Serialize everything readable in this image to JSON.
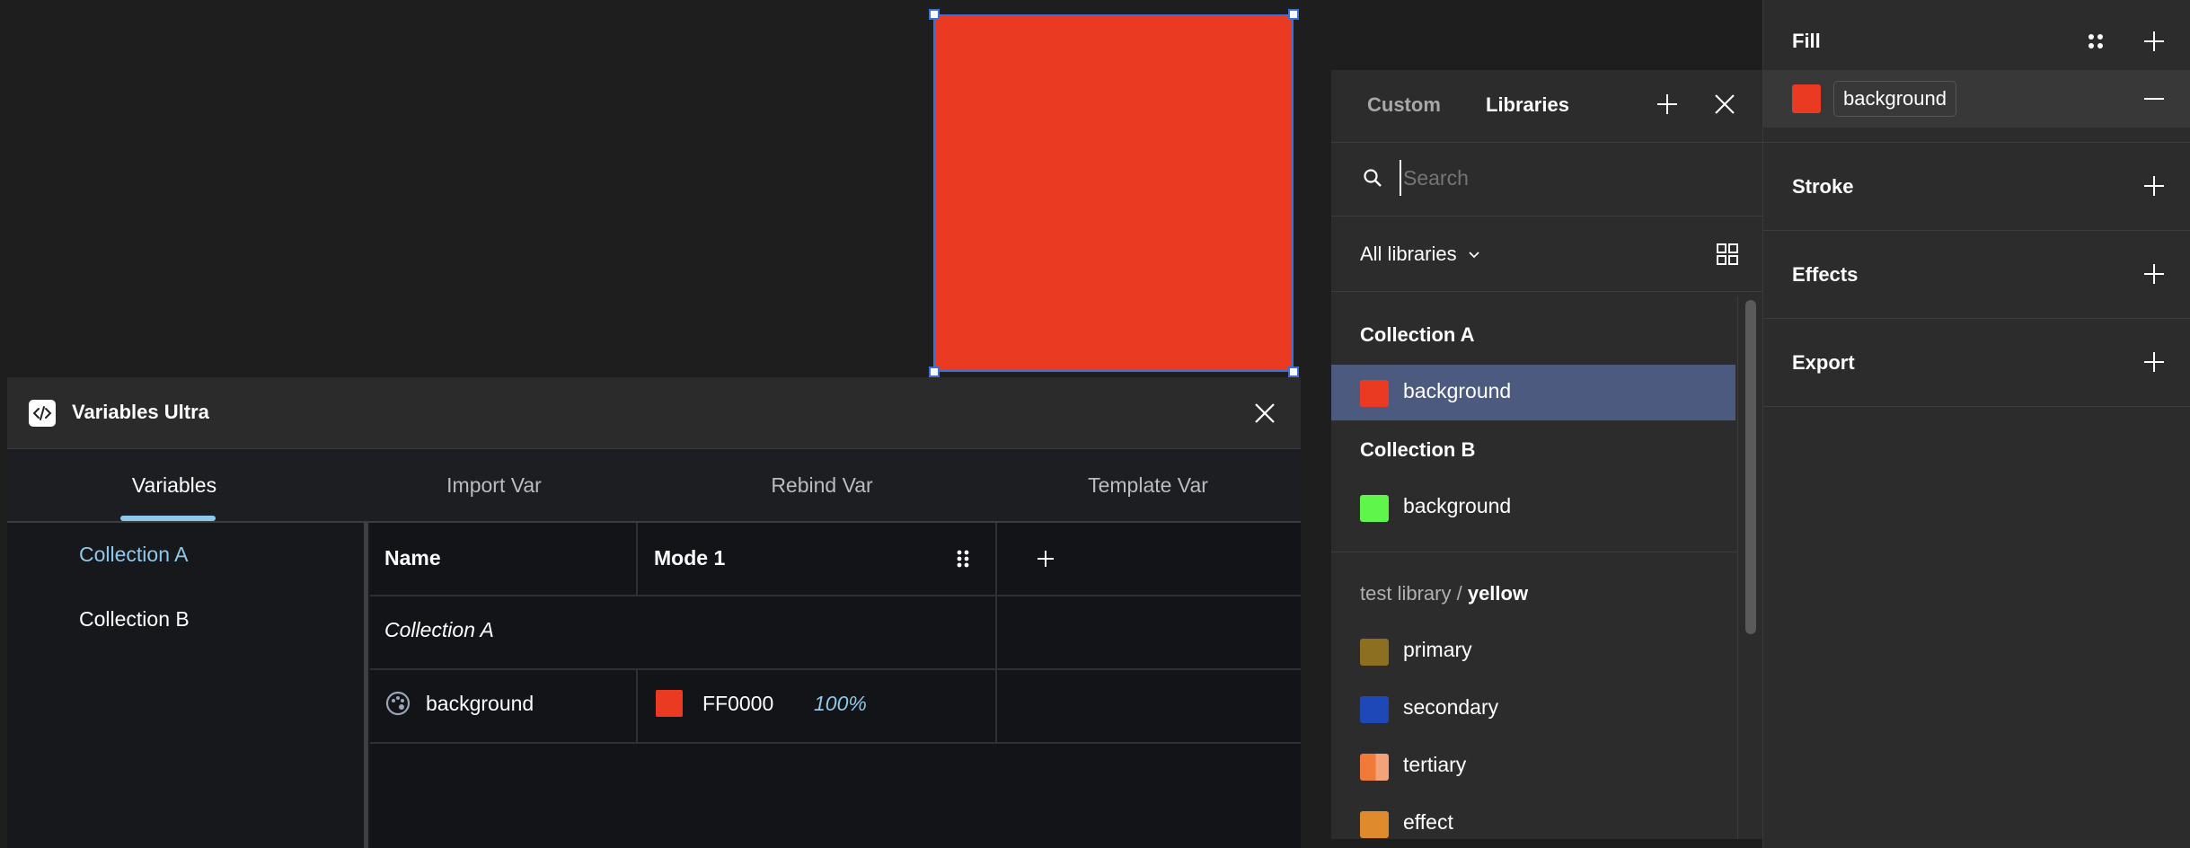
{
  "plugin": {
    "title": "Variables Ultra",
    "tabs": [
      "Variables",
      "Import Var",
      "Rebind Var",
      "Template Var"
    ],
    "collections": [
      "Collection A",
      "Collection B"
    ],
    "table": {
      "col_name": "Name",
      "col_mode": "Mode 1",
      "group_label": "Collection A",
      "row": {
        "name": "background",
        "hex": "FF0000",
        "opacity": "100%",
        "swatch": "#ea3a22"
      }
    }
  },
  "libraries": {
    "tab_custom": "Custom",
    "tab_libraries": "Libraries",
    "search_placeholder": "Search",
    "filter_label": "All libraries",
    "group_a": "Collection A",
    "group_a_item": {
      "name": "background",
      "color": "#ea3a22"
    },
    "group_b": "Collection B",
    "group_b_item": {
      "name": "background",
      "color": "#5ff54a"
    },
    "library_path": "test library /",
    "library_name": "yellow",
    "items": [
      {
        "name": "primary",
        "color": "#8c6f20"
      },
      {
        "name": "secondary",
        "color": "#1e47b8"
      },
      {
        "name": "tertiary",
        "color": "#f07a3a"
      },
      {
        "name": "effect",
        "color": "#e08a2e"
      }
    ]
  },
  "properties": {
    "fill_title": "Fill",
    "fill_variable": "background",
    "fill_color": "#ea3a22",
    "stroke_title": "Stroke",
    "effects_title": "Effects",
    "export_title": "Export"
  },
  "colors": {
    "accent_blue": "#3d6fd9",
    "tab_indicator": "#8ec8ea",
    "selected_row": "#4b5a7e"
  }
}
